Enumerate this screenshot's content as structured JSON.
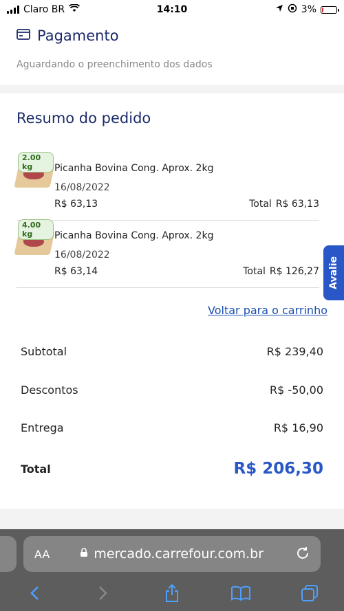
{
  "status": {
    "carrier": "Claro BR",
    "time": "14:10",
    "battery": "3%"
  },
  "payment": {
    "title": "Pagamento",
    "subtitle": "Aguardando o preenchimento dos dados"
  },
  "summary": {
    "title": "Resumo do pedido",
    "items": [
      {
        "weight": "2.00 kg",
        "name": "Picanha Bovina Cong. Aprox. 2kg",
        "date": "16/08/2022",
        "price": "R$ 63,13",
        "total_label": "Total",
        "total": "R$ 63,13"
      },
      {
        "weight": "4.00 kg",
        "name": "Picanha Bovina Cong. Aprox. 2kg",
        "date": "16/08/2022",
        "price": "R$ 63,14",
        "total_label": "Total",
        "total": "R$ 126,27"
      }
    ],
    "back_link": "Voltar para o carrinho",
    "subtotal_label": "Subtotal",
    "subtotal": "R$ 239,40",
    "discount_label": "Descontos",
    "discount": "R$ -50,00",
    "delivery_label": "Entrega",
    "delivery": "R$ 16,90",
    "total_label": "Total",
    "total": "R$ 206,30"
  },
  "feedback_tab": "Avalie",
  "browser": {
    "aa_label": "AA",
    "url": "mercado.carrefour.com.br"
  },
  "colors": {
    "brand": "#1b2a6b",
    "accent": "#2a57c7"
  }
}
